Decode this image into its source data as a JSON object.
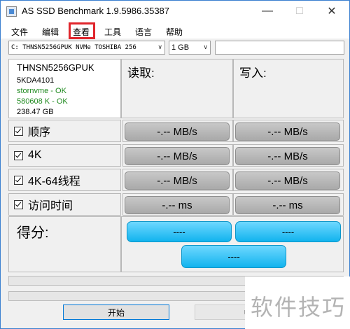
{
  "window": {
    "title": "AS SSD Benchmark 1.9.5986.35387"
  },
  "menu": {
    "items": [
      "文件",
      "编辑",
      "查看",
      "工具",
      "语言",
      "帮助"
    ]
  },
  "drive_select": {
    "value": "C: THNSN5256GPUK NVMe TOSHIBA 256"
  },
  "size_select": {
    "value": "1 GB"
  },
  "drive_info": {
    "model": "THNSN5256GPUK",
    "firmware": "5KDA4101",
    "driver": "stornvme - OK",
    "alignment": "580608 K - OK",
    "capacity": "238.47 GB"
  },
  "columns": {
    "read": "读取:",
    "write": "写入:"
  },
  "tests": [
    {
      "label": "顺序",
      "read": "-.-- MB/s",
      "write": "-.-- MB/s"
    },
    {
      "label": "4K",
      "read": "-.-- MB/s",
      "write": "-.-- MB/s"
    },
    {
      "label": "4K-64线程",
      "read": "-.-- MB/s",
      "write": "-.-- MB/s"
    },
    {
      "label": "访问时间",
      "read": "-.-- ms",
      "write": "-.-- ms"
    }
  ],
  "score": {
    "label": "得分:",
    "read": "----",
    "write": "----",
    "total": "----"
  },
  "buttons": {
    "start": "开始",
    "abort": "中"
  },
  "watermark": "软件技巧",
  "colors": {
    "highlight": "#e0262c",
    "score_fill": "#11b3ee",
    "result_button": "#b0b0b0"
  }
}
